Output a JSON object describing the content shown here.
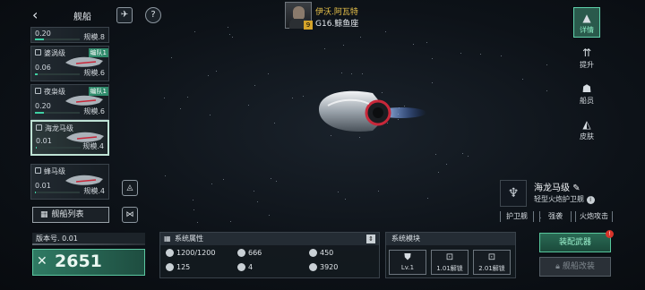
{
  "header": {
    "back_icon": "chevron-left-icon",
    "title": "舰船",
    "rocket_icon": "rocket-icon",
    "help_icon": "question-icon",
    "help_label": "?"
  },
  "captain": {
    "name": "伊沃.阿瓦特",
    "location": "G16.鲸鱼座",
    "level": "9"
  },
  "fleet_list": {
    "partial_card": {
      "value": "0.20",
      "scale": "规模.8",
      "progress": 0.2
    },
    "cards": [
      {
        "name": "婆涡级",
        "badge": "编队1",
        "value": "0.06",
        "scale": "规模.6",
        "progress": 0.06,
        "selected": false
      },
      {
        "name": "夜枭级",
        "badge": "编队1",
        "value": "0.20",
        "scale": "规模.6",
        "progress": 0.2,
        "selected": false
      },
      {
        "name": "海龙马级",
        "badge": "",
        "value": "0.01",
        "scale": "规模.4",
        "progress": 0.01,
        "selected": true
      },
      {
        "name": "蜂马级",
        "badge": "",
        "value": "0.01",
        "scale": "规模.4",
        "progress": 0.01,
        "selected": false
      }
    ],
    "list_button": "舰船列表"
  },
  "right_nav": [
    {
      "label": "详情",
      "icon": "detail-icon",
      "selected": true
    },
    {
      "label": "提升",
      "icon": "upgrade-icon",
      "selected": false
    },
    {
      "label": "船员",
      "icon": "crew-icon",
      "selected": false
    },
    {
      "label": "皮肤",
      "icon": "skin-icon",
      "selected": false
    }
  ],
  "ship_info": {
    "name": "海龙马级",
    "type": "轻型火炮护卫舰",
    "tags": [
      "护卫舰",
      "强袭",
      "火炮攻击"
    ]
  },
  "version": {
    "label": "版本号. 0.01"
  },
  "power": {
    "value": "2651"
  },
  "system_attributes": {
    "title": "系统属性",
    "stats": [
      {
        "icon": "structure-icon",
        "value": "1200/1200"
      },
      {
        "icon": "armor-icon",
        "value": "666"
      },
      {
        "icon": "shield-icon",
        "value": "450"
      },
      {
        "icon": "speed-icon",
        "value": "125"
      },
      {
        "icon": "slots-icon",
        "value": "4"
      },
      {
        "icon": "cargo-icon",
        "value": "3920"
      }
    ]
  },
  "system_modules": {
    "title": "系统模块",
    "slots": [
      {
        "label": "Lv.1",
        "icon": "module-icon"
      },
      {
        "label": "1.01解锁",
        "icon": "lock-icon"
      },
      {
        "label": "2.01解锁",
        "icon": "lock-icon"
      }
    ]
  },
  "actions": {
    "equip": "装配武器",
    "equip_notice": "!",
    "modify": "舰船改装"
  },
  "colors": {
    "accent": "#3fd0a3",
    "accent_dark": "#2a6a54",
    "gold": "#e8c24a"
  }
}
